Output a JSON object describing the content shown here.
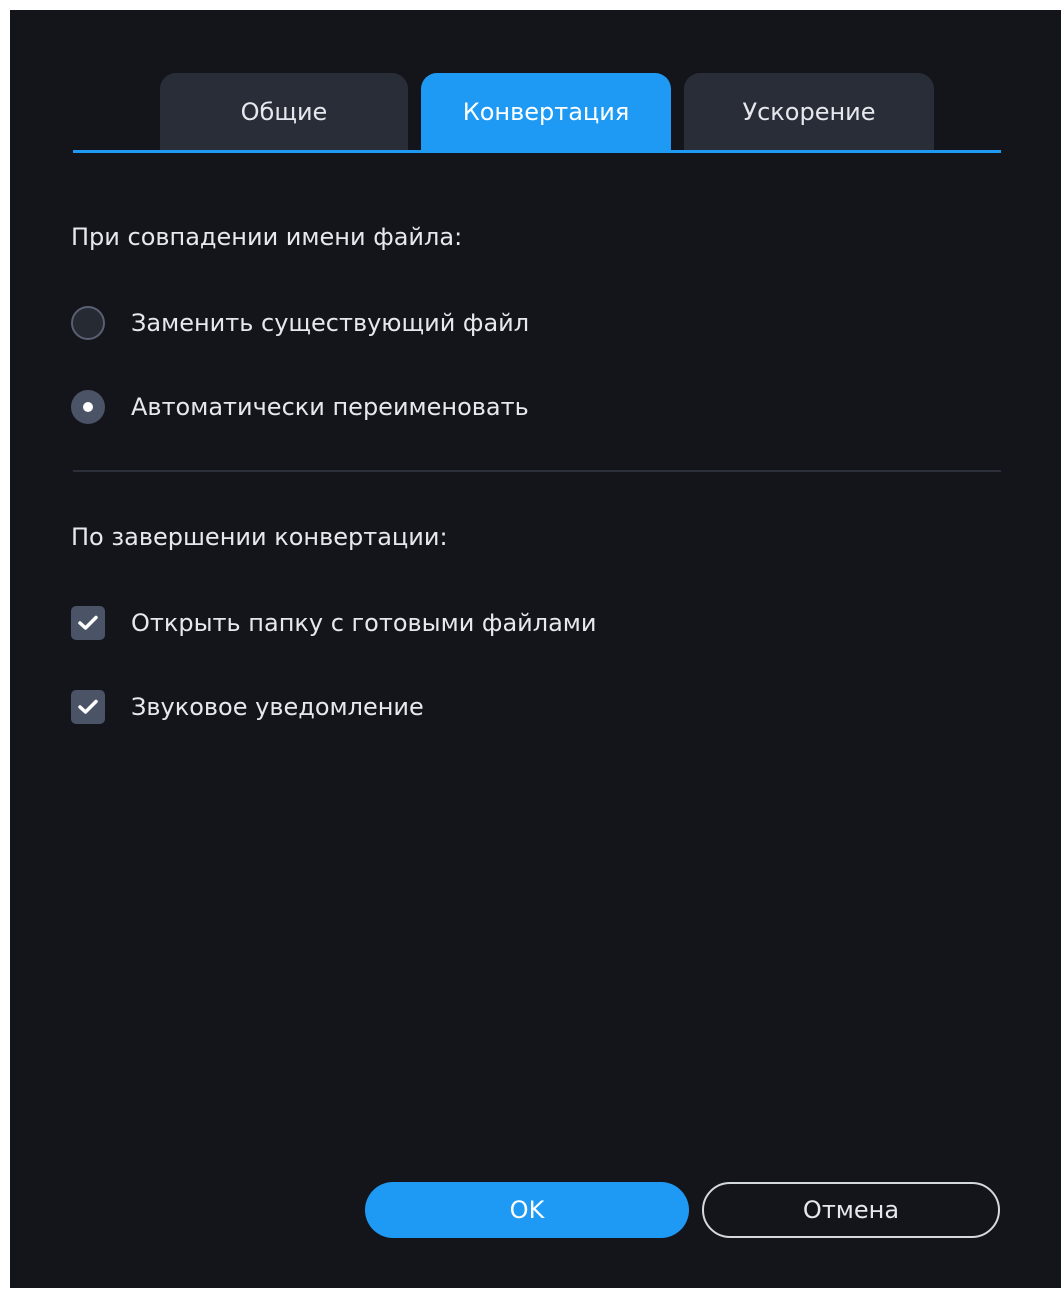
{
  "tabs": [
    {
      "label": "Общие",
      "active": false
    },
    {
      "label": "Конвертация",
      "active": true
    },
    {
      "label": "Ускорение",
      "active": false
    }
  ],
  "file_conflict": {
    "title": "При совпадении имени файла:",
    "options": [
      {
        "label": "Заменить существующий файл",
        "checked": false
      },
      {
        "label": "Автоматически переименовать",
        "checked": true
      }
    ]
  },
  "after_conversion": {
    "title": "По завершении конвертации:",
    "options": [
      {
        "label": "Открыть папку с готовыми файлами",
        "checked": true
      },
      {
        "label": "Звуковое уведомление",
        "checked": true
      }
    ]
  },
  "buttons": {
    "ok_label": "OK",
    "cancel_label": "Отмена"
  },
  "colors": {
    "background": "#13151b",
    "accent": "#1e9af4",
    "tab_inactive": "#292d38",
    "control": "#4b5366",
    "text": "#e6e8ed"
  },
  "icons": {
    "checkmark": "checkmark-icon"
  }
}
